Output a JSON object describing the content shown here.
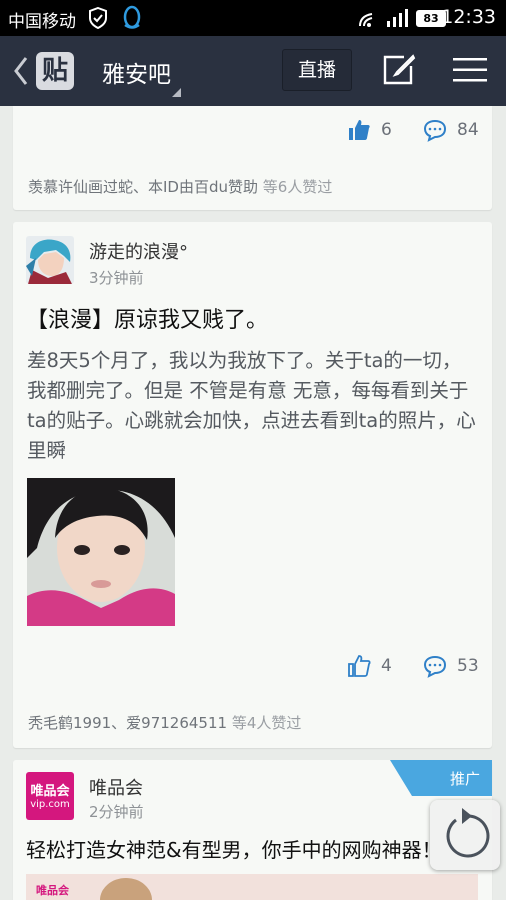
{
  "status_bar": {
    "carrier": "中国移动",
    "battery": "83",
    "time": "12:33"
  },
  "nav": {
    "logo": "贴",
    "title": "雅安吧",
    "live_label": "直播"
  },
  "posts": [
    {
      "likes": "6",
      "comments": "84",
      "likers": "羡慕许仙画过蛇、本ID由百du赞助",
      "likers_suffix": "等6人赞过"
    },
    {
      "author": "游走的浪漫°",
      "time": "3分钟前",
      "title": "【浪漫】原谅我又贱了。",
      "body": "差8天5个月了，我以为我放下了。关于ta的一切，我都删完了。但是 不管是有意 无意，每每看到关于ta的贴子。心跳就会加快，点进去看到ta的照片，心里瞬",
      "likes": "4",
      "comments": "53",
      "likers": "秃毛鹤1991、爱971264511",
      "likers_suffix": "等4人赞过"
    }
  ],
  "ad": {
    "tag": "推广",
    "brand": "唯品会",
    "logo_top": "唯品会",
    "logo_bottom": "vip.com",
    "time": "2分钟前",
    "title": "轻松打造女神范&有型男，你手中的网购神器！",
    "image_logo": "唯品会"
  },
  "colors": {
    "nav_bg": "#2a3140",
    "accent": "#2f80c8",
    "ad_tag": "#4aa7e0",
    "vip_pink": "#d4177e"
  }
}
